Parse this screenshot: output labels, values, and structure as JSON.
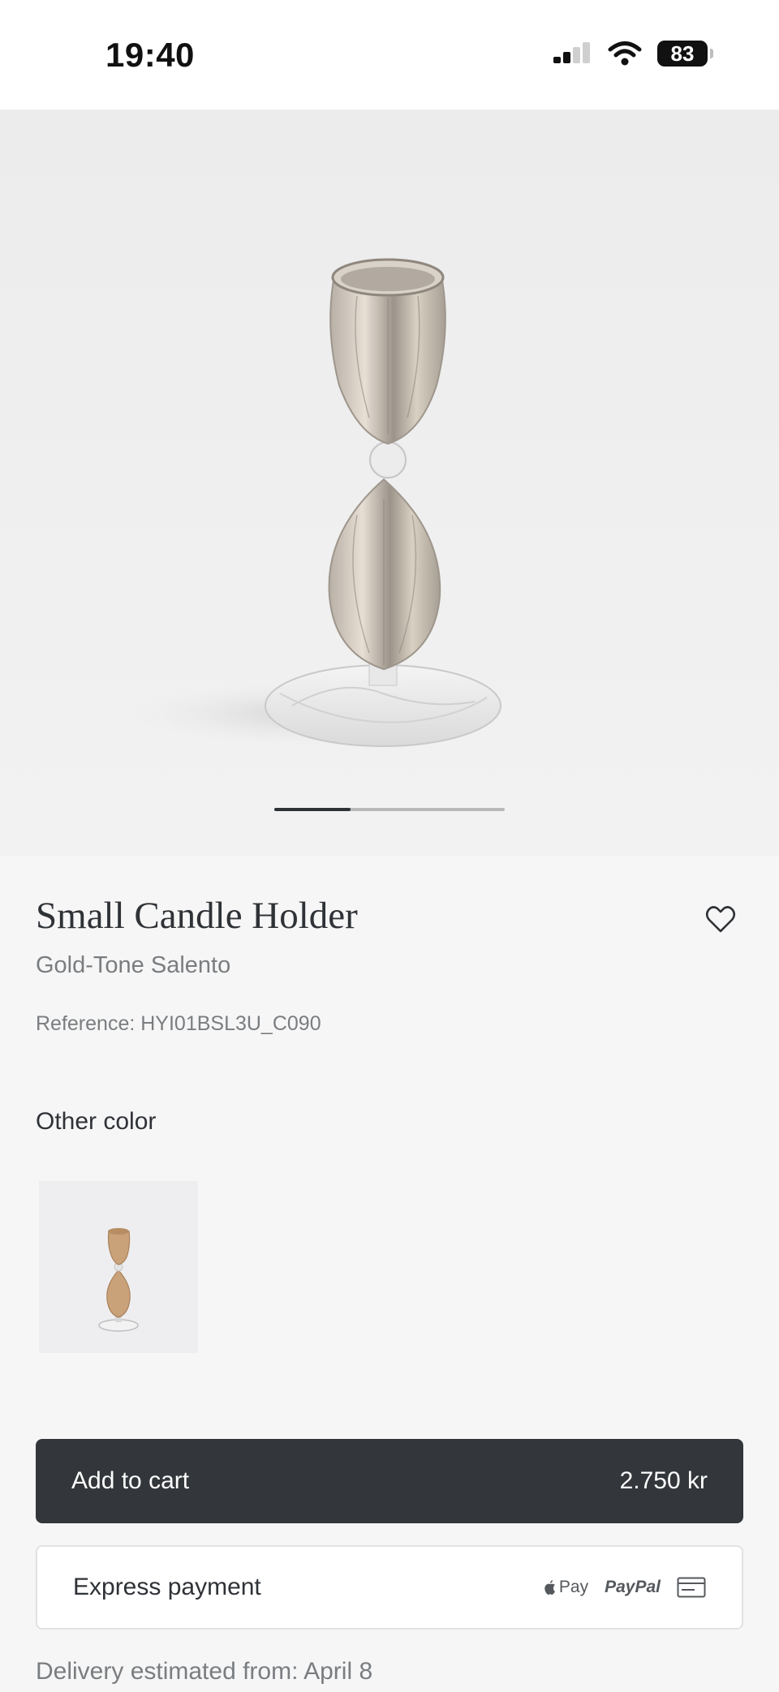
{
  "status_bar": {
    "time": "19:40",
    "battery": "83"
  },
  "carousel": {
    "active_fraction": 0.33
  },
  "product": {
    "title": "Small Candle Holder",
    "subtitle": "Gold-Tone Salento",
    "reference": "Reference: HYI01BSL3U_C090"
  },
  "colors": {
    "label": "Other color"
  },
  "cart": {
    "label": "Add to cart",
    "price": "2.750 kr"
  },
  "express": {
    "label": "Express payment",
    "applepay": "Pay",
    "paypal": "PayPal"
  },
  "delivery": "Delivery estimated from: April 8",
  "icons": [
    "signal-icon",
    "wifi-icon",
    "battery-icon",
    "heart-icon",
    "apple-icon",
    "card-icon"
  ]
}
